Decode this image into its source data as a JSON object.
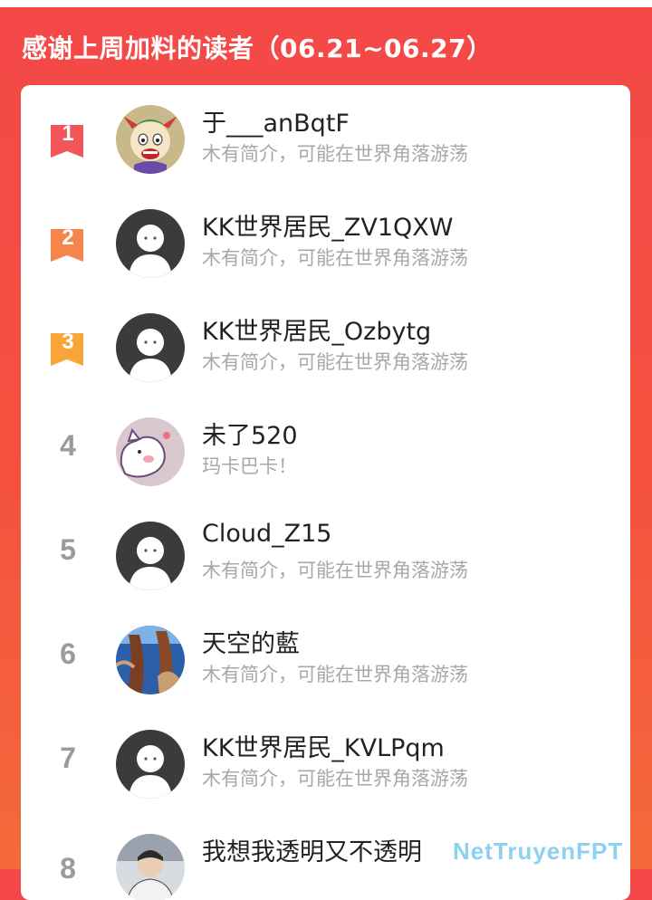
{
  "header": {
    "title": "感谢上周加料的读者（06.21~06.27）"
  },
  "readers": [
    {
      "rank": "1",
      "name": "于___anBqtF",
      "bio": "木有简介，可能在世界角落游荡",
      "avatar": "joker-avatar-icon"
    },
    {
      "rank": "2",
      "name": "KK世界居民_ZV1QXW",
      "bio": "木有简介，可能在世界角落游荡",
      "avatar": "default-user-avatar-icon"
    },
    {
      "rank": "3",
      "name": "KK世界居民_Ozbytg",
      "bio": "木有简介，可能在世界角落游荡",
      "avatar": "default-user-avatar-icon"
    },
    {
      "rank": "4",
      "name": "未了520",
      "bio": "玛卡巴卡！",
      "avatar": "cartoon-pig-avatar-icon"
    },
    {
      "rank": "5",
      "name": "Cloud_Z15",
      "bio": "木有简介，可能在世界角落游荡",
      "avatar": "default-user-avatar-icon"
    },
    {
      "rank": "6",
      "name": "天空的藍",
      "bio": "木有简介，可能在世界角落游荡",
      "avatar": "photo-avatar-icon"
    },
    {
      "rank": "7",
      "name": "KK世界居民_KVLPqm",
      "bio": "木有简介，可能在世界角落游荡",
      "avatar": "default-user-avatar-icon"
    },
    {
      "rank": "8",
      "name": "我想我透明又不透明",
      "bio": "",
      "avatar": "photo-avatar-icon"
    }
  ],
  "badge_colors": {
    "gold": "#f2555a",
    "silver": "#f7844a",
    "bronze": "#f8a63a"
  },
  "watermark": "NetTruyenFPT"
}
